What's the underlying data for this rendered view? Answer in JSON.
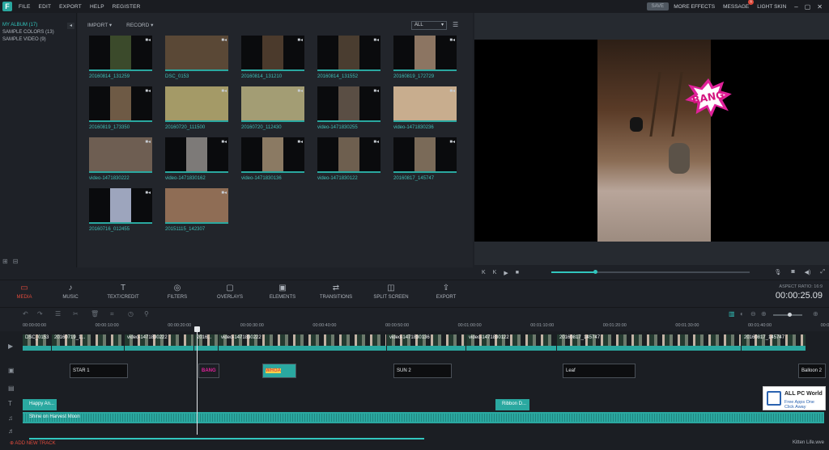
{
  "menu": {
    "logo": "F",
    "items": [
      "FILE",
      "EDIT",
      "EXPORT",
      "HELP",
      "REGISTER"
    ]
  },
  "topright": {
    "save": "SAVE",
    "more_effects": "MORE EFFECTS",
    "message": "MESSAGE",
    "message_badge": "1",
    "skin": "LIGHT SKIN"
  },
  "sidebar": {
    "items": [
      "MY ALBUM (17)",
      "SAMPLE COLORS (13)",
      "SAMPLE VIDEO (9)"
    ]
  },
  "library": {
    "import": "IMPORT",
    "record": "RECORD",
    "filter": "ALL",
    "items": [
      {
        "name": "20160814_131259",
        "color": "#3b4a2b"
      },
      {
        "name": "DSC_0153",
        "color": "#5a4836",
        "wide": true
      },
      {
        "name": "20160814_131210",
        "color": "#4b3a2c"
      },
      {
        "name": "20160814_131552",
        "color": "#4a3d30"
      },
      {
        "name": "20160819_172729",
        "color": "#8c7562"
      },
      {
        "name": "20160819_173350",
        "color": "#6e5a45"
      },
      {
        "name": "20160720_111500",
        "color": "#a49a67",
        "wide": true
      },
      {
        "name": "20160720_112430",
        "color": "#a39d74",
        "wide": true
      },
      {
        "name": "video-1471830255",
        "color": "#5a4e44"
      },
      {
        "name": "video-1471830236",
        "color": "#c8ad8e",
        "wide": true
      },
      {
        "name": "video-1471830222",
        "color": "#6e5e52",
        "wide": true
      },
      {
        "name": "video-1471830162",
        "color": "#7d7a78"
      },
      {
        "name": "video-1471830136",
        "color": "#8b7a63"
      },
      {
        "name": "video-1471830122",
        "color": "#6e5f4f"
      },
      {
        "name": "20160817_145747",
        "color": "#7a6a58"
      },
      {
        "name": "20160716_012455",
        "color": "#9da5bd"
      },
      {
        "name": "20151115_142307",
        "color": "#8f6d55",
        "wide": true
      }
    ]
  },
  "preview": {
    "sticker": "BANG"
  },
  "tabs": [
    "MEDIA",
    "MUSIC",
    "TEXT/CREDIT",
    "FILTERS",
    "OVERLAYS",
    "ELEMENTS",
    "TRANSITIONS",
    "SPLIT SCREEN",
    "EXPORT"
  ],
  "aspect": "ASPECT RATIO: 16:9",
  "timecode": "00:00:25.09",
  "ruler": [
    "00:00:00:00",
    "00:00:10:00",
    "00:00:20:00",
    "00:00:30:00",
    "00:00:40:00",
    "00:00:50:00",
    "00:01:00:00",
    "00:01:10:00",
    "00:01:20:00",
    "00:01:30:00",
    "00:01:40:00",
    "00:01:50:00"
  ],
  "video_clips": [
    {
      "label": "DSC_0153",
      "w": 36
    },
    {
      "label": "20160719_1...",
      "w": 90
    },
    {
      "label": "video-1471830222",
      "w": 86
    },
    {
      "label": "2016...",
      "w": 30
    },
    {
      "label": "video-1471830222",
      "w": 208
    },
    {
      "label": "video-1471830136",
      "w": 98
    },
    {
      "label": "video-1471830122",
      "w": 112
    },
    {
      "label": "20160817_145747",
      "w": 228
    },
    {
      "label": "20160817_145747",
      "w": 80
    }
  ],
  "pip_clips": [
    {
      "label": "STAR 1"
    },
    {
      "label": "BANG"
    },
    {
      "label": "WHOA"
    },
    {
      "label": "SUN 2"
    },
    {
      "label": "Leaf"
    },
    {
      "label": "Balloon 2"
    }
  ],
  "text_clips": [
    {
      "label": "Happy An..."
    },
    {
      "label": "Ribbon D..."
    }
  ],
  "audio": {
    "label": "Shine on Harvest Moon"
  },
  "footer": {
    "add_track": "ADD NEW TRACK",
    "project": "Kitten Life.wve"
  },
  "watermark": {
    "line1": "ALL PC World",
    "line2": "Free Apps One Click Away"
  }
}
